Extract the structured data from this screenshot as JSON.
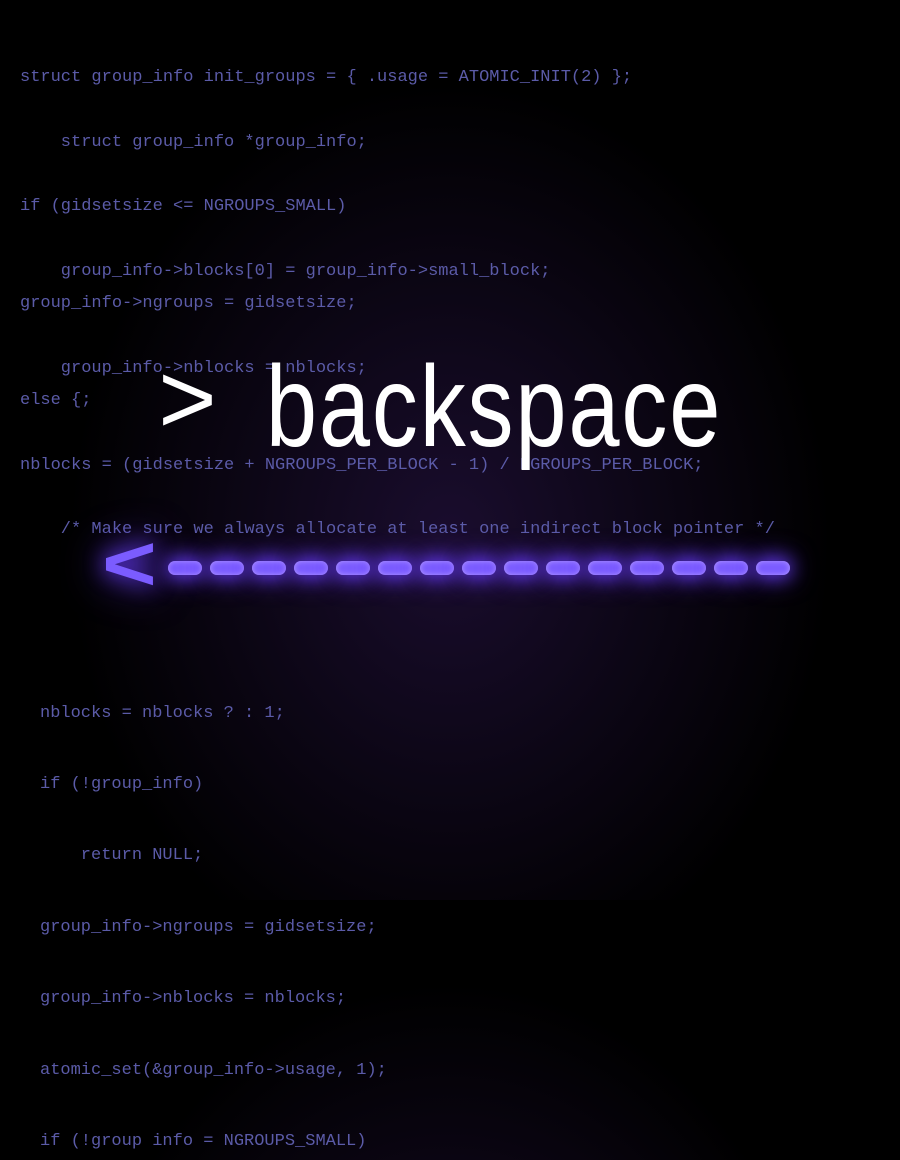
{
  "code_top": {
    "l1": "struct group_info init_groups = { .usage = ATOMIC_INIT(2) };",
    "l2": "    struct group_info *group_info;",
    "l3": "if (gidsetsize <= NGROUPS_SMALL)",
    "l4": "    group_info->blocks[0] = group_info->small_block;",
    "l5": "group_info->ngroups = gidsetsize;",
    "l6": "    group_info->nblocks = nblocks;",
    "l7": "else {;",
    "l8": "nblocks = (gidsetsize + NGROUPS_PER_BLOCK - 1) / NGROUPS_PER_BLOCK;",
    "l9": "    /* Make sure we always allocate at least one indirect block pointer */"
  },
  "logo": {
    "prompt": ">",
    "word": "backspace"
  },
  "arrow": {
    "head": "<",
    "dash_count": 15
  },
  "code_bottom": {
    "l1": "nblocks = nblocks ? : 1;",
    "l2": "if (!group_info)",
    "l3": "    return NULL;",
    "l4": "group_info->ngroups = gidsetsize;",
    "l5": "group_info->nblocks = nblocks;",
    "l6": "atomic_set(&group_info->usage, 1);",
    "l7": "if (!group info = NGROUPS_SMALL)"
  }
}
